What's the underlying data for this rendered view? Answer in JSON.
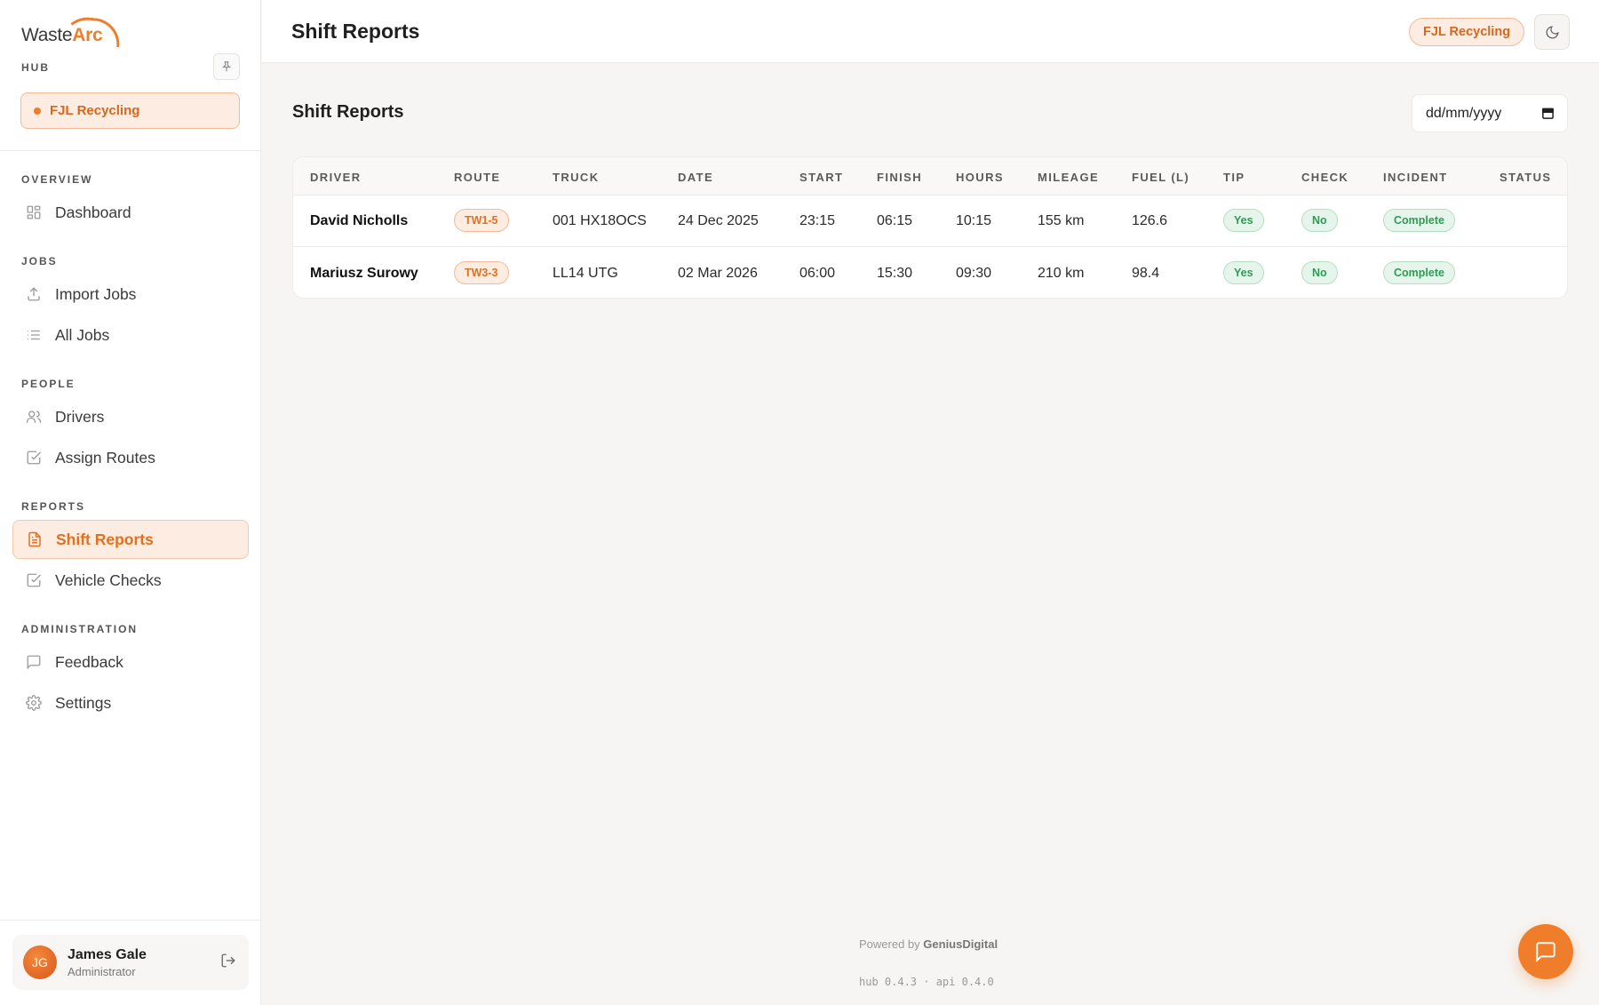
{
  "brand": {
    "name_part1": "Waste",
    "name_part2": "Arc",
    "sub": "HUB"
  },
  "sidebar": {
    "org": "FJL Recycling",
    "sections": [
      {
        "title": "OVERVIEW",
        "items": [
          {
            "label": "Dashboard",
            "icon": "dashboard-icon"
          }
        ]
      },
      {
        "title": "JOBS",
        "items": [
          {
            "label": "Import Jobs",
            "icon": "upload-icon"
          },
          {
            "label": "All Jobs",
            "icon": "list-icon"
          }
        ]
      },
      {
        "title": "PEOPLE",
        "items": [
          {
            "label": "Drivers",
            "icon": "users-icon"
          },
          {
            "label": "Assign Routes",
            "icon": "checkbox-icon"
          }
        ]
      },
      {
        "title": "REPORTS",
        "items": [
          {
            "label": "Shift Reports",
            "icon": "document-icon",
            "active": true
          },
          {
            "label": "Vehicle Checks",
            "icon": "checkbox-icon"
          }
        ]
      },
      {
        "title": "ADMINISTRATION",
        "items": [
          {
            "label": "Feedback",
            "icon": "message-icon"
          },
          {
            "label": "Settings",
            "icon": "gear-icon"
          }
        ]
      }
    ],
    "user": {
      "initials": "JG",
      "name": "James Gale",
      "role": "Administrator"
    }
  },
  "header": {
    "title": "Shift Reports",
    "org_badge": "FJL Recycling"
  },
  "main": {
    "heading": "Shift Reports",
    "date_placeholder": "dd/mm/yyyy",
    "columns": [
      "DRIVER",
      "ROUTE",
      "TRUCK",
      "DATE",
      "START",
      "FINISH",
      "HOURS",
      "MILEAGE",
      "FUEL (L)",
      "TIP",
      "CHECK",
      "INCIDENT",
      "STATUS"
    ],
    "rows": [
      {
        "driver": "David Nicholls",
        "route": "TW1-5",
        "truck": "001 HX18OCS",
        "date": "24 Dec 2025",
        "start": "23:15",
        "finish": "06:15",
        "hours": "10:15",
        "mileage": "155 km",
        "fuel": "126.6",
        "tip": "Yes",
        "check": "No",
        "incident": "Complete",
        "status": ""
      },
      {
        "driver": "Mariusz Surowy",
        "route": "TW3-3",
        "truck": "LL14 UTG",
        "date": "02 Mar 2026",
        "start": "06:00",
        "finish": "15:30",
        "hours": "09:30",
        "mileage": "210 km",
        "fuel": "98.4",
        "tip": "Yes",
        "check": "No",
        "incident": "Complete",
        "status": ""
      }
    ]
  },
  "footer": {
    "powered_prefix": "Powered by",
    "powered_brand": "GeniusDigital",
    "version": "hub 0.4.3 · api 0.4.0"
  },
  "colors": {
    "accent": "#ef7d2a",
    "success": "#2f9b54"
  }
}
